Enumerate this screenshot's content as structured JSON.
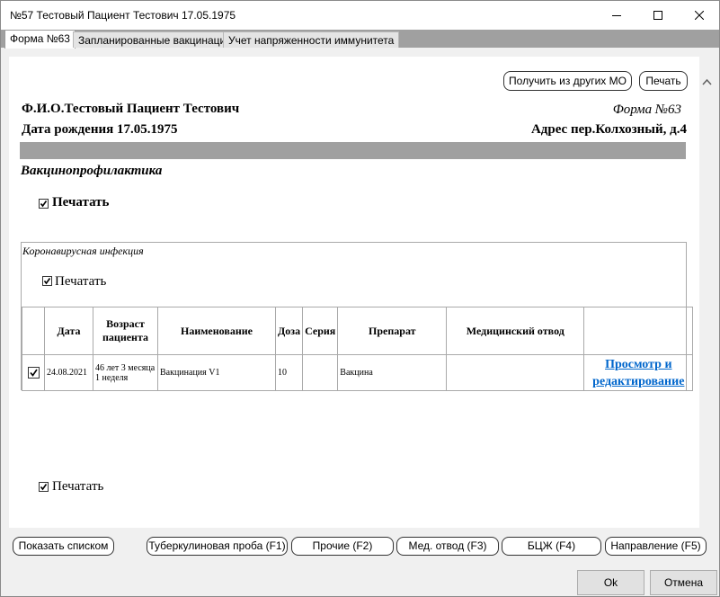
{
  "window": {
    "title": "№57 Тестовый Пациент Тестович 17.05.1975"
  },
  "tabs": [
    {
      "label": "Форма №63"
    },
    {
      "label": "Запланированные вакцинации"
    },
    {
      "label": "Учет напряженности иммунитета"
    }
  ],
  "toolbar": {
    "get_from_mo": "Получить из других МО",
    "print": "Печать"
  },
  "patient": {
    "fio": "Ф.И.О.Тестовый Пациент Тестович",
    "form": "Форма №63",
    "birth": "Дата рождения 17.05.1975",
    "address": "Адрес пер.Колхозный, д.4"
  },
  "section": {
    "title": "Вакцинопрофилактика",
    "print_label": "Печатать",
    "print_checked": true
  },
  "group": {
    "title": "Коронавирусная инфекция",
    "print_label": "Печатать",
    "print_checked": true,
    "columns": [
      "",
      "Дата",
      "Возраст пациента",
      "Наименование",
      "Доза",
      "Серия",
      "Препарат",
      "Медицинский отвод",
      ""
    ],
    "rows": [
      {
        "checked": true,
        "date": "24.08.2021",
        "age": "46 лет 3 месяца 1 неделя",
        "name": "Вакцинация V1",
        "dose": "10",
        "series": "",
        "drug": "Вакцина",
        "medical_exemption": "",
        "action": "Просмотр и редактирование"
      }
    ]
  },
  "bottom_print": {
    "label": "Печатать",
    "checked": true
  },
  "bottom_buttons": {
    "show_list": "Показать списком",
    "tuberculin": "Туберкулиновая проба (F1)",
    "other": "Прочие (F2)",
    "med_exemption": "Мед. отвод (F3)",
    "bcg": "БЦЖ (F4)",
    "referral": "Направление (F5)"
  },
  "footer": {
    "ok": "Ok",
    "cancel": "Отмена"
  },
  "colors": {
    "link": "#0066cc",
    "tab_bar": "#a0a0a0",
    "band": "#a0a0a0"
  }
}
